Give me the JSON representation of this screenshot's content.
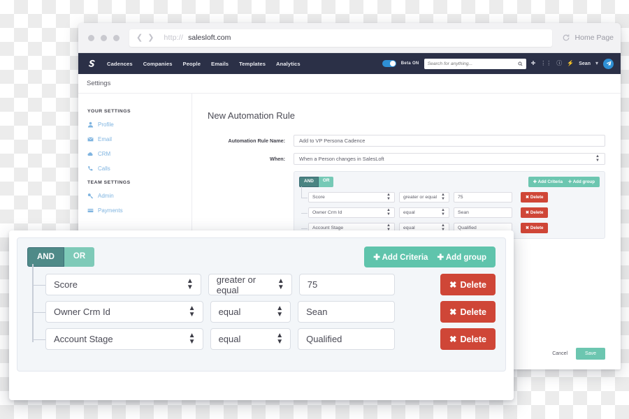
{
  "browser": {
    "scheme": "http://",
    "host": "salesloft.com",
    "back_icon": "chevron-left-icon",
    "forward_icon": "chevron-right-icon",
    "refresh_icon": "refresh-icon",
    "home_label": "Home Page"
  },
  "appnav": {
    "logo": "salesloft-logo",
    "links": [
      "Cadences",
      "Companies",
      "People",
      "Emails",
      "Templates",
      "Analytics"
    ],
    "beta_label": "Beta ON",
    "beta_on": true,
    "search_placeholder": "Search for anything...",
    "search_value": "",
    "icons": [
      "plus-icon",
      "sliders-icon",
      "info-icon",
      "bolt-icon"
    ],
    "user_name": "Sean",
    "avatar_icon": "send-icon",
    "bg_color": "#2b3047",
    "accent_blue": "#2e8fd4"
  },
  "page": {
    "settings_title": "Settings",
    "heading": "New Automation Rule"
  },
  "sidebar": {
    "your_settings_header": "YOUR SETTINGS",
    "your_settings": [
      {
        "label": "Profile",
        "icon": "user-icon"
      },
      {
        "label": "Email",
        "icon": "envelope-icon"
      },
      {
        "label": "CRM",
        "icon": "cloud-icon"
      },
      {
        "label": "Calls",
        "icon": "phone-icon"
      }
    ],
    "team_settings_header": "TEAM SETTINGS",
    "team_settings": [
      {
        "label": "Admin",
        "icon": "key-icon"
      },
      {
        "label": "Payments",
        "icon": "credit-card-icon"
      }
    ],
    "link_color": "#7fb4e0"
  },
  "form": {
    "rule_name_label": "Automation Rule Name:",
    "rule_name_value": "Add to VP Persona Cadence",
    "when_label": "When:",
    "when_value": "When a Person changes in SalesLoft"
  },
  "criteria_group": {
    "and_label": "AND",
    "or_label": "OR",
    "selected_operator": "AND",
    "add_criteria_label": "Add Criteria",
    "add_criteria_icon": "plus-icon",
    "add_group_label": "Add group",
    "add_group_icon": "circle-plus-icon",
    "delete_label": "Delete",
    "delete_icon": "x-icon",
    "teal": "#5fc4ac",
    "teal_dark": "#4f8a88",
    "teal_light": "#7ecab8",
    "red": "#cf4637",
    "rows": [
      {
        "field": "Score",
        "operator": "greater or equal",
        "value": "75"
      },
      {
        "field": "Owner Crm Id",
        "operator": "equal",
        "value": "Sean"
      },
      {
        "field": "Account Stage",
        "operator": "equal",
        "value": "Qualified"
      }
    ]
  },
  "footer": {
    "cancel_label": "Cancel",
    "save_label": "Save",
    "remove_icon": "x-icon"
  }
}
